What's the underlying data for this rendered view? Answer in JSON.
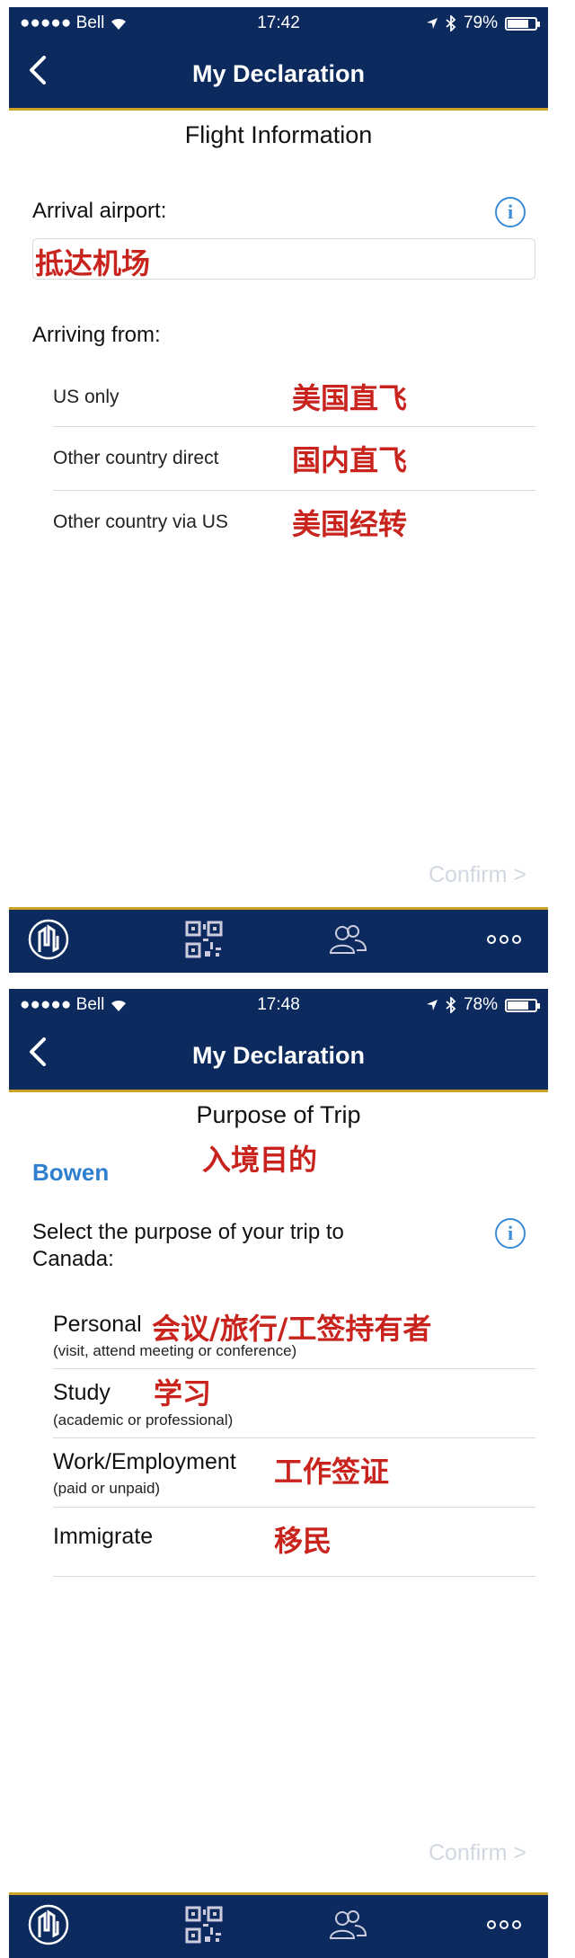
{
  "screens": [
    {
      "status": {
        "carrier": "●●●●● Bell",
        "time": "17:42",
        "battery": "79%",
        "battery_level": 0.79
      },
      "nav": {
        "title": "My Declaration"
      },
      "section_title": "Flight Information",
      "arrival_label": "Arrival airport:",
      "arrival_annotation": "抵达机场",
      "arriving_from_label": "Arriving from:",
      "options": [
        {
          "label": "US only",
          "annotation": "美国直飞"
        },
        {
          "label": "Other country direct",
          "annotation": "国内直飞"
        },
        {
          "label": "Other country via US",
          "annotation": "美国经转"
        }
      ],
      "confirm": "Confirm >",
      "tabs": [
        {
          "icon": "cbsa-logo-icon"
        },
        {
          "icon": "qr-code-icon"
        },
        {
          "icon": "people-icon"
        },
        {
          "icon": "more-icon"
        }
      ]
    },
    {
      "status": {
        "carrier": "●●●●● Bell",
        "time": "17:48",
        "battery": "78%",
        "battery_level": 0.78
      },
      "nav": {
        "title": "My Declaration"
      },
      "section_title": "Purpose of Trip",
      "section_annotation": "入境目的",
      "traveller_name": "Bowen",
      "question_line1": "Select the purpose of your trip to",
      "question_line2": "Canada:",
      "purposes": [
        {
          "label": "Personal",
          "sub": "(visit, attend meeting or conference)",
          "annotation": "会议/旅行/工签持有者"
        },
        {
          "label": "Study",
          "sub": "(academic or professional)",
          "annotation": "学习"
        },
        {
          "label": "Work/Employment",
          "sub": "(paid or unpaid)",
          "annotation": "工作签证"
        },
        {
          "label": "Immigrate",
          "sub": "",
          "annotation": "移民"
        }
      ],
      "confirm": "Confirm >",
      "tabs": [
        {
          "icon": "cbsa-logo-icon"
        },
        {
          "icon": "qr-code-icon"
        },
        {
          "icon": "people-icon"
        },
        {
          "icon": "more-icon"
        }
      ]
    }
  ]
}
